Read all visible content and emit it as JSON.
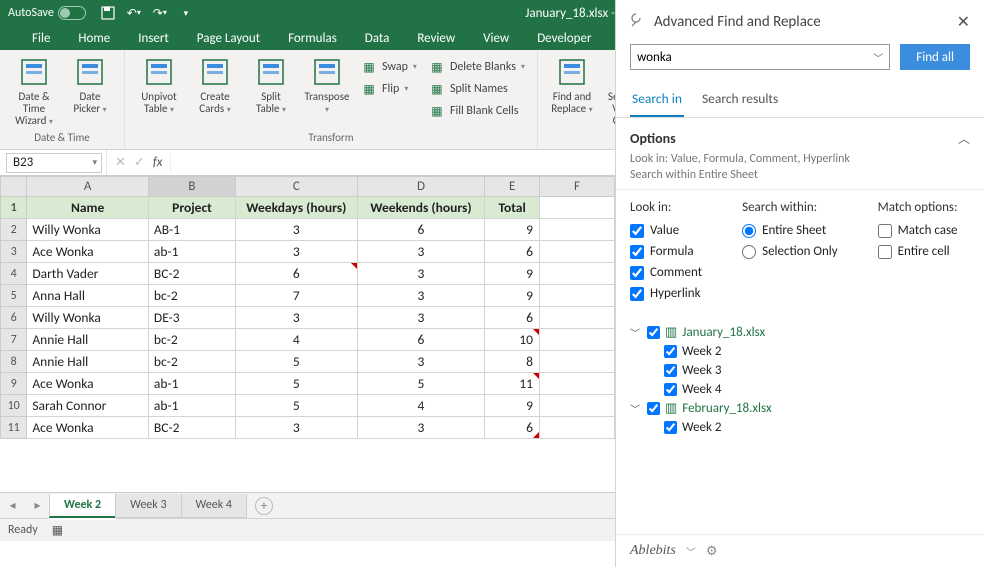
{
  "titlebar": {
    "autosave_label": "AutoSave",
    "filename": "January_18.xlsx",
    "app": "Excel"
  },
  "maintabs": [
    "File",
    "Home",
    "Insert",
    "Page Layout",
    "Formulas",
    "Data",
    "Review",
    "View",
    "Developer"
  ],
  "ribbon": {
    "groups": [
      {
        "label": "Date & Time",
        "big": [
          {
            "label": "Date &\nTime Wizard"
          },
          {
            "label": "Date\nPicker"
          }
        ],
        "small": []
      },
      {
        "label": "Transform",
        "big": [
          {
            "label": "Unpivot\nTable"
          },
          {
            "label": "Create\nCards"
          },
          {
            "label": "Split\nTable"
          },
          {
            "label": "Transpose"
          }
        ],
        "small": [
          {
            "label": "Swap"
          },
          {
            "label": "Flip"
          },
          {
            "label": "Delete Blanks"
          },
          {
            "label": "Split Names"
          },
          {
            "label": "Fill Blank Cells"
          }
        ]
      },
      {
        "label": "",
        "big": [
          {
            "label": "Find and\nReplace"
          },
          {
            "label": "Select by\nValue / Color"
          }
        ],
        "small": []
      }
    ]
  },
  "namebox": "B23",
  "columns": [
    "",
    "A",
    "B",
    "C",
    "D",
    "E",
    "F"
  ],
  "headers": [
    "Name",
    "Project",
    "Weekdays (hours)",
    "Weekends (hours)",
    "Total"
  ],
  "rows": [
    {
      "n": "Willy Wonka",
      "p": "AB-1",
      "wd": 3,
      "we": 6,
      "t": 9
    },
    {
      "n": "Ace Wonka",
      "p": "ab-1",
      "wd": 3,
      "we": 3,
      "t": 6
    },
    {
      "n": "Darth Vader",
      "p": "BC-2",
      "wd": 6,
      "we": 3,
      "t": 9,
      "tri_wd": true
    },
    {
      "n": "Anna Hall",
      "p": "bc-2",
      "wd": 7,
      "we": 3,
      "t": 9
    },
    {
      "n": "Willy Wonka",
      "p": "DE-3",
      "wd": 3,
      "we": 3,
      "t": 6
    },
    {
      "n": "Annie Hall",
      "p": "bc-2",
      "wd": 4,
      "we": 6,
      "t": 10,
      "tri_t": true
    },
    {
      "n": "Annie Hall",
      "p": "bc-2",
      "wd": 5,
      "we": 3,
      "t": 8
    },
    {
      "n": "Ace Wonka",
      "p": "ab-1",
      "wd": 5,
      "we": 5,
      "t": 11,
      "tri_t": true
    },
    {
      "n": "Sarah Connor",
      "p": "ab-1",
      "wd": 5,
      "we": 4,
      "t": 9
    },
    {
      "n": "Ace Wonka",
      "p": "BC-2",
      "wd": 3,
      "we": 3,
      "t": 6,
      "tri_t_br": true
    }
  ],
  "sheets": [
    "Week 2",
    "Week 3",
    "Week 4"
  ],
  "status": "Ready",
  "pane": {
    "title": "Advanced Find and Replace",
    "search_value": "wonka",
    "findall": "Find all",
    "tabs": [
      "Search in",
      "Search results"
    ],
    "options_title": "Options",
    "options_sub1": "Look in: Value, Formula, Comment, Hyperlink",
    "options_sub2": "Search within Entire Sheet",
    "lookin_title": "Look in:",
    "lookin": [
      "Value",
      "Formula",
      "Comment",
      "Hyperlink"
    ],
    "searchwithin_title": "Search within:",
    "searchwithin": [
      "Entire Sheet",
      "Selection Only"
    ],
    "match_title": "Match options:",
    "match": [
      "Match case",
      "Entire cell"
    ],
    "tree": [
      {
        "type": "file",
        "label": "January_18.xlsx"
      },
      {
        "type": "sheet",
        "label": "Week 2"
      },
      {
        "type": "sheet",
        "label": "Week 3"
      },
      {
        "type": "sheet",
        "label": "Week 4"
      },
      {
        "type": "file",
        "label": "February_18.xlsx"
      },
      {
        "type": "sheet",
        "label": "Week 2"
      }
    ],
    "brand": "Ablebits"
  }
}
